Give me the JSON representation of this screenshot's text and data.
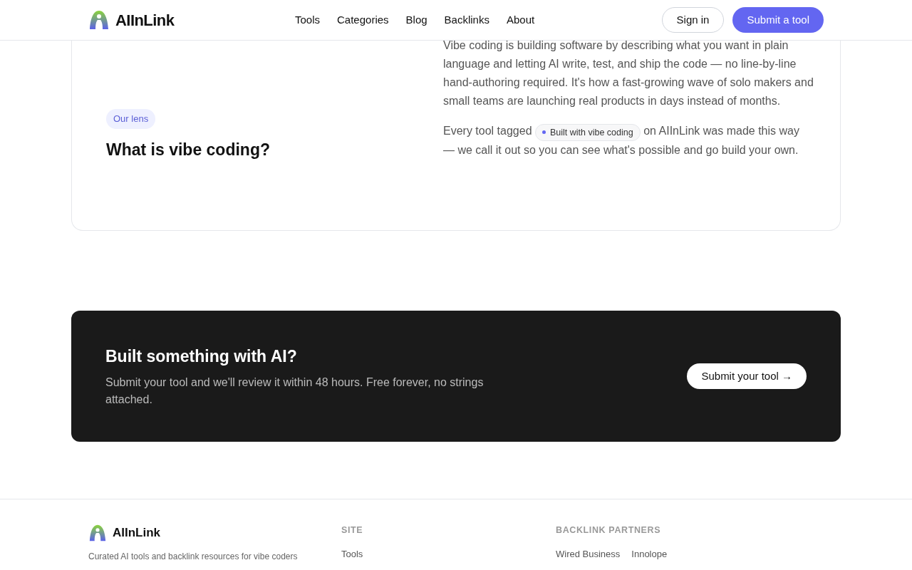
{
  "header": {
    "brand": "AIInLink",
    "nav": [
      {
        "label": "Tools"
      },
      {
        "label": "Categories"
      },
      {
        "label": "Blog"
      },
      {
        "label": "Backlinks"
      },
      {
        "label": "About"
      }
    ],
    "sign_in": "Sign in",
    "submit": "Submit a tool"
  },
  "lens": {
    "badge": "Our lens",
    "title": "What is vibe coding?",
    "paragraph_1": "Vibe coding is building software by describing what you want in plain language and letting AI write, test, and ship the code — no line-by-line hand-authoring required. It's how a fast-growing wave of solo makers and small teams are launching real products in days instead of months.",
    "paragraph_2_before": "Every tool tagged",
    "tag": "Built with vibe coding",
    "paragraph_2_after": "on AIInLink was made this way — we call it out so you can see what's possible and go build your own."
  },
  "cta": {
    "title": "Built something with AI?",
    "text": "Submit your tool and we'll review it within 48 hours. Free forever, no strings attached.",
    "button": "Submit your tool →"
  },
  "footer": {
    "brand": "AIInLink",
    "tagline": "Curated AI tools and backlink resources for vibe coders",
    "columns": [
      {
        "heading": "SITE",
        "links": [
          "Tools"
        ]
      },
      {
        "heading": "BACKLINK PARTNERS",
        "links": [
          "Wired Business",
          "Innolope"
        ]
      }
    ]
  }
}
